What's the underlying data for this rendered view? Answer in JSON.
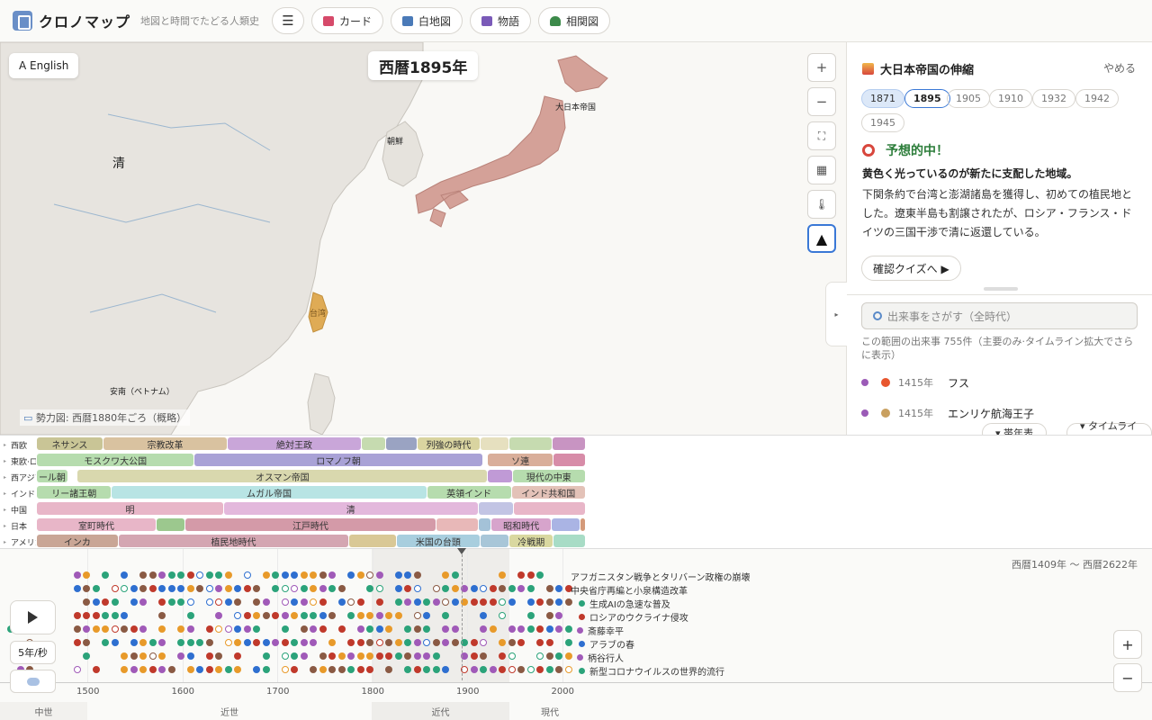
{
  "header": {
    "title": "クロノマップ",
    "subtitle": "地図と時間でたどる人類史",
    "nav": [
      {
        "label": "カード",
        "icon": "card-icon",
        "color": "#d64a6a"
      },
      {
        "label": "白地図",
        "icon": "map-icon",
        "color": "#4a7ab8"
      },
      {
        "label": "物語",
        "icon": "book-icon",
        "color": "#7a5ab8"
      },
      {
        "label": "相関図",
        "icon": "tree-icon",
        "color": "#3c8a4a"
      }
    ]
  },
  "map": {
    "lang_button": "A English",
    "year_badge": "西暦1895年",
    "caption": "勢力図: 西暦1880年ごろ（概略）",
    "labels": {
      "qing": "清",
      "korea": "朝鮮",
      "japan": "大日本帝国",
      "taiwan": "台湾",
      "vietnam": "安南（ベトナム）"
    },
    "controls": [
      "+",
      "−",
      "⛶",
      "▦",
      "🌡",
      "▲"
    ],
    "colors": {
      "japan": "#d4a198",
      "taiwan": "#dfab55",
      "land": "#e7e4df",
      "sea": "#f9f8f5"
    }
  },
  "panel": {
    "story_title": "大日本帝国の伸縮",
    "quit": "やめる",
    "years": [
      "1871",
      "1895",
      "1905",
      "1910",
      "1932",
      "1942",
      "1945"
    ],
    "active_year": "1895",
    "result_title": "予想的中！",
    "lead": "黄色く光っているのが新たに支配した地域。",
    "body": "下関条約で台湾と澎湖諸島を獲得し、初めての植民地とした。遼東半島も割譲されたが、ロシア・フランス・ドイツの三国干渉で清に返還している。",
    "quiz_button": "確認クイズへ ▶",
    "search_placeholder": "出来事をさがす（全時代）",
    "search_info": "この範囲の出来事 755件（主要のみ·タイムライン拡大でさらに表示）",
    "events": [
      {
        "year": "1415年",
        "name": "フス",
        "icon_color": "#e8562e"
      },
      {
        "year": "1415年",
        "name": "エンリケ航海王子",
        "icon_color": "#c9a060"
      }
    ],
    "chronology_button": "▾ 帯年表",
    "timeline_button": "▾ タイムライン"
  },
  "bands": [
    {
      "label": "西欧",
      "items": [
        {
          "text": "ネサンス",
          "color": "#c9c596",
          "from": 1420,
          "to": 1517
        },
        {
          "text": "宗教改革",
          "color": "#d9c2a0",
          "from": 1517,
          "to": 1648
        },
        {
          "text": "絶対王政",
          "color": "#c9a6d9",
          "from": 1648,
          "to": 1789
        },
        {
          "text": "",
          "color": "#c6dbb0",
          "from": 1789,
          "to": 1815
        },
        {
          "text": "",
          "color": "#9aa3c2",
          "from": 1815,
          "to": 1848
        },
        {
          "text": "列強の時代",
          "color": "#d9d4a0",
          "from": 1848,
          "to": 1914
        },
        {
          "text": "",
          "color": "#e6e0bf",
          "from": 1914,
          "to": 1945
        },
        {
          "text": "",
          "color": "#c6dbb0",
          "from": 1945,
          "to": 1990
        },
        {
          "text": "",
          "color": "#c894c2",
          "from": 1990,
          "to": 2025
        }
      ]
    },
    {
      "label": "東欧·ロシア",
      "items": [
        {
          "text": "モスクワ大公国",
          "color": "#b6dcae",
          "from": 1420,
          "to": 1613
        },
        {
          "text": "ロマノフ朝",
          "color": "#a9a2d6",
          "from": 1613,
          "to": 1917
        },
        {
          "text": "ソ連",
          "color": "#d9ae9a",
          "from": 1922,
          "to": 1991
        },
        {
          "text": "",
          "color": "#d78ca8",
          "from": 1991,
          "to": 2025
        }
      ]
    },
    {
      "label": "西アジア",
      "items": [
        {
          "text": "ール朝",
          "color": "#b6dcae",
          "from": 1420,
          "to": 1480
        },
        {
          "text": "オスマン帝国",
          "color": "#d9d8ae",
          "from": 1490,
          "to": 1922
        },
        {
          "text": "",
          "color": "#c09ad6",
          "from": 1922,
          "to": 1948
        },
        {
          "text": "現代の中東",
          "color": "#b6dcae",
          "from": 1948,
          "to": 2025
        }
      ]
    },
    {
      "label": "インド",
      "items": [
        {
          "text": "リー諸王朝",
          "color": "#b6dcae",
          "from": 1420,
          "to": 1526
        },
        {
          "text": "ムガル帝国",
          "color": "#b8e4e4",
          "from": 1526,
          "to": 1858
        },
        {
          "text": "英領インド",
          "color": "#b6dcae",
          "from": 1858,
          "to": 1947
        },
        {
          "text": "インド共和国",
          "color": "#e3c2b8",
          "from": 1947,
          "to": 2025
        }
      ]
    },
    {
      "label": "中国",
      "items": [
        {
          "text": "明",
          "color": "#e8b6c8",
          "from": 1420,
          "to": 1644
        },
        {
          "text": "清",
          "color": "#e3b8dc",
          "from": 1644,
          "to": 1912
        },
        {
          "text": "",
          "color": "#c2c4e4",
          "from": 1912,
          "to": 1949
        },
        {
          "text": "",
          "color": "#e8b6c8",
          "from": 1949,
          "to": 2025
        }
      ]
    },
    {
      "label": "日本",
      "items": [
        {
          "text": "室町時代",
          "color": "#e8b6c8",
          "from": 1420,
          "to": 1573
        },
        {
          "text": "",
          "color": "#9cc88e",
          "from": 1573,
          "to": 1603
        },
        {
          "text": "江戸時代",
          "color": "#d49aa8",
          "from": 1603,
          "to": 1868
        },
        {
          "text": "",
          "color": "#e8b8b8",
          "from": 1868,
          "to": 1912
        },
        {
          "text": "",
          "color": "#a4c2d8",
          "from": 1912,
          "to": 1926
        },
        {
          "text": "昭和時代",
          "color": "#d7a4cc",
          "from": 1926,
          "to": 1989
        },
        {
          "text": "",
          "color": "#aab4e4",
          "from": 1989,
          "to": 2019
        },
        {
          "text": "",
          "color": "#d49a7a",
          "from": 2019,
          "to": 2025
        }
      ]
    },
    {
      "label": "アメリカ大陸",
      "items": [
        {
          "text": "インカ",
          "color": "#c9a696",
          "from": 1420,
          "to": 1533
        },
        {
          "text": "植民地時代",
          "color": "#d4a6b2",
          "from": 1533,
          "to": 1776
        },
        {
          "text": "",
          "color": "#d9c896",
          "from": 1776,
          "to": 1826
        },
        {
          "text": "米国の台頭",
          "color": "#a8cede",
          "from": 1826,
          "to": 1914
        },
        {
          "text": "",
          "color": "#a8c6d8",
          "from": 1914,
          "to": 1945
        },
        {
          "text": "冷戦期",
          "color": "#d9d8a0",
          "from": 1945,
          "to": 1991
        },
        {
          "text": "",
          "color": "#a8dcc6",
          "from": 1991,
          "to": 2025
        }
      ]
    }
  ],
  "timeline": {
    "range": "西暦1409年 〜 西暦2622年",
    "ticks": [
      "1500",
      "1600",
      "1700",
      "1800",
      "1900",
      "2000"
    ],
    "eras": [
      "中世",
      "近世",
      "近代",
      "現代"
    ],
    "play_speed": "5年/秒",
    "event_labels": [
      {
        "text": "アフガニスタン戦争とタリバーン政権の崩壊",
        "color": ""
      },
      {
        "text": "中央省庁再編と小泉構造改革",
        "color": ""
      },
      {
        "text": "生成AIの急速な普及",
        "color": "#2ba37a"
      },
      {
        "text": "ロシアのウクライナ侵攻",
        "color": "#c0392b"
      },
      {
        "text": "斎藤幸平",
        "color": "#a05ab8"
      },
      {
        "text": "アラブの春",
        "color": "#2e6fd0"
      },
      {
        "text": "柄谷行人",
        "color": "#a05ab8"
      },
      {
        "text": "新型コロナウイルスの世界的流行",
        "color": "#2ba37a"
      }
    ],
    "dot_palette": [
      "#c0392b",
      "#2ba37a",
      "#2e6fd0",
      "#a05ab8",
      "#e89a2a",
      "#8a5a44"
    ]
  }
}
